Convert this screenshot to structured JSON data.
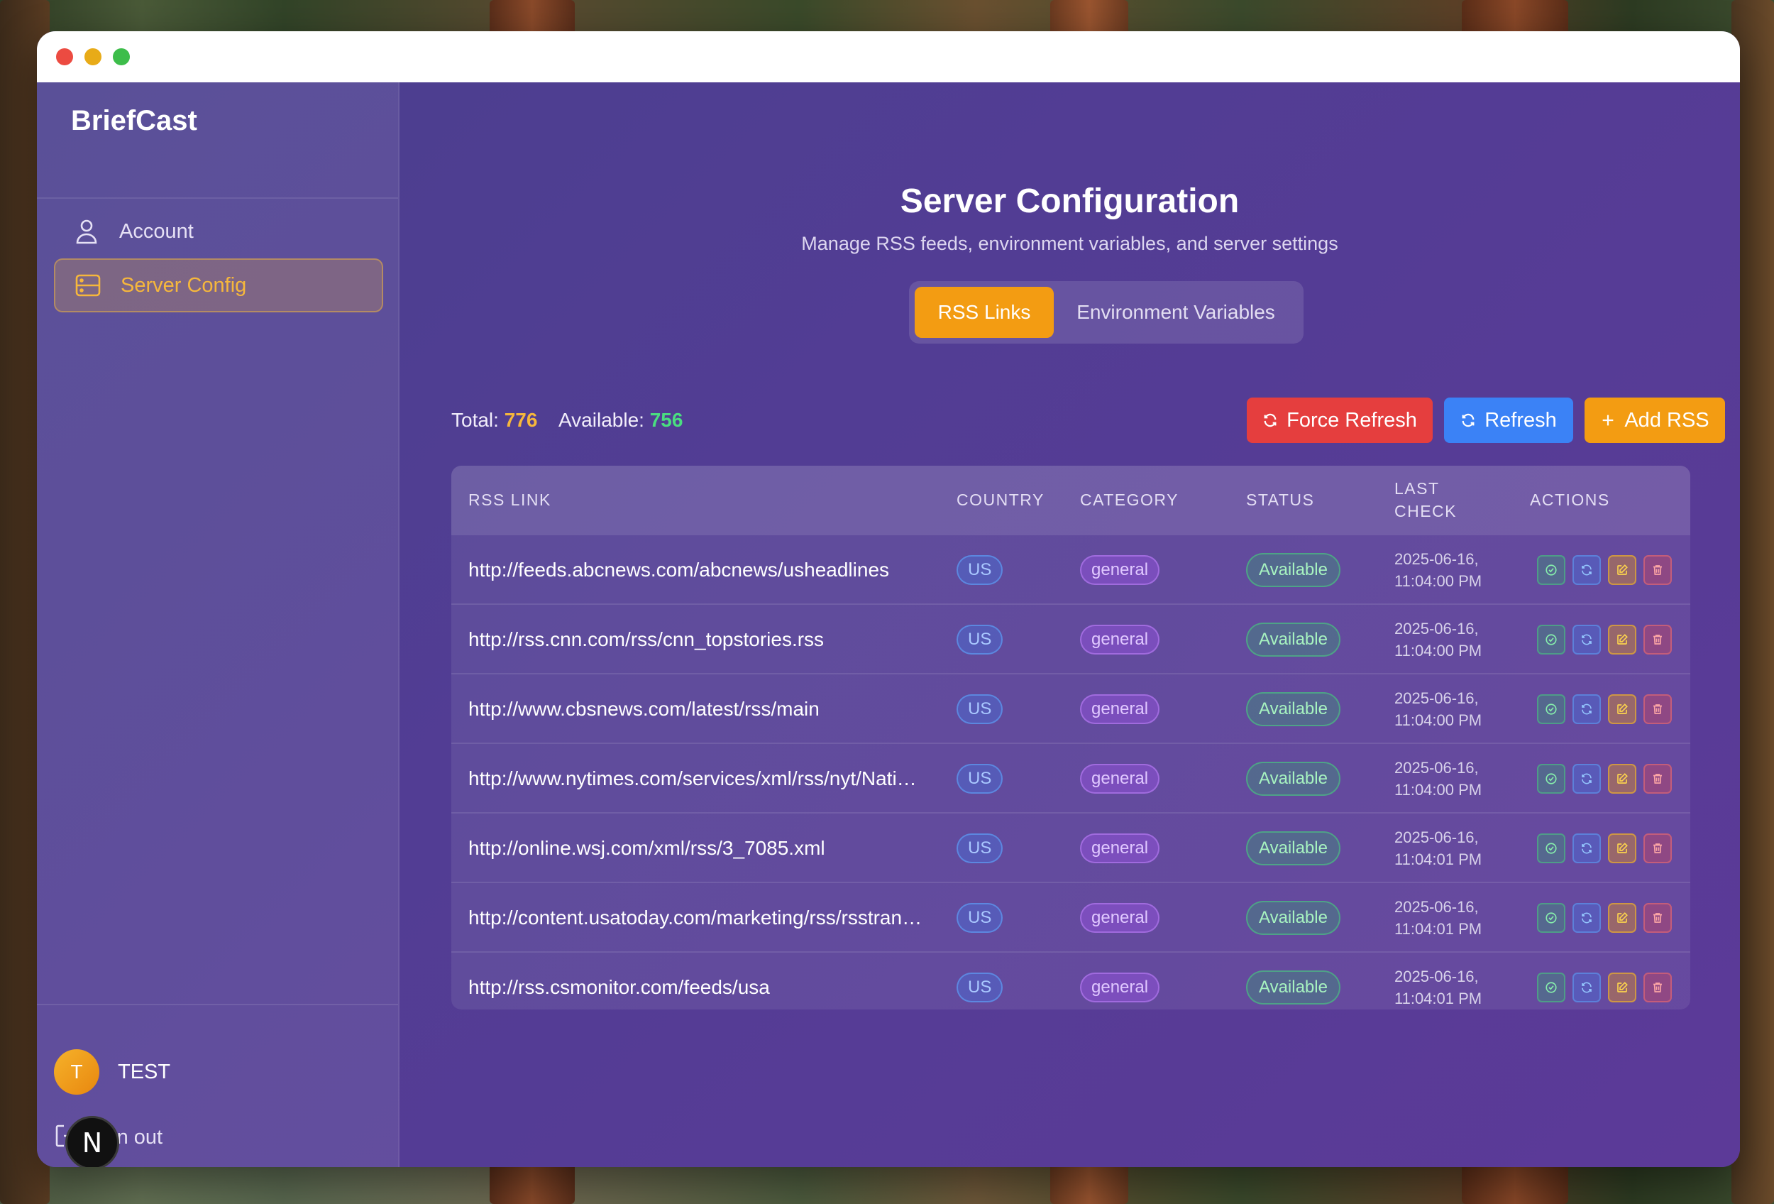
{
  "window": {
    "traffic_lights": [
      "#ec4b41",
      "#e8ab18",
      "#3dbd4a"
    ]
  },
  "sidebar": {
    "brand": "BriefCast",
    "items": [
      {
        "label": "Account",
        "icon": "user-icon",
        "active": false
      },
      {
        "label": "Server Config",
        "icon": "server-icon",
        "active": true
      }
    ],
    "user": {
      "initial": "T",
      "name": "TEST"
    },
    "signout_label": "ign out",
    "overlay_badge": "N"
  },
  "main": {
    "title": "Server Configuration",
    "subtitle": "Manage RSS feeds, environment variables, and server settings",
    "tabs": [
      {
        "label": "RSS Links",
        "active": true
      },
      {
        "label": "Environment Variables",
        "active": false
      }
    ],
    "stats": {
      "total_label": "Total:",
      "total_value": "776",
      "available_label": "Available:",
      "available_value": "756"
    },
    "buttons": {
      "force_refresh": "Force Refresh",
      "refresh": "Refresh",
      "add_rss": "Add RSS"
    },
    "colors": {
      "accent": "#f39c12",
      "danger": "#e53e3e",
      "primary": "#3b82f6",
      "total_value": "#f6b73c",
      "available_value": "#4ade80"
    }
  },
  "table": {
    "headers": {
      "link": "RSS LINK",
      "country": "COUNTRY",
      "category": "CATEGORY",
      "status": "STATUS",
      "last_check_1": "LAST",
      "last_check_2": "CHECK",
      "actions": "ACTIONS"
    },
    "rows": [
      {
        "link": "http://feeds.abcnews.com/abcnews/usheadlines",
        "country": "US",
        "category": "general",
        "status": "Available",
        "date": "2025-06-16,",
        "time": "11:04:00 PM"
      },
      {
        "link": "http://rss.cnn.com/rss/cnn_topstories.rss",
        "country": "US",
        "category": "general",
        "status": "Available",
        "date": "2025-06-16,",
        "time": "11:04:00 PM"
      },
      {
        "link": "http://www.cbsnews.com/latest/rss/main",
        "country": "US",
        "category": "general",
        "status": "Available",
        "date": "2025-06-16,",
        "time": "11:04:00 PM"
      },
      {
        "link": "http://www.nytimes.com/services/xml/rss/nyt/Nati…",
        "country": "US",
        "category": "general",
        "status": "Available",
        "date": "2025-06-16,",
        "time": "11:04:00 PM"
      },
      {
        "link": "http://online.wsj.com/xml/rss/3_7085.xml",
        "country": "US",
        "category": "general",
        "status": "Available",
        "date": "2025-06-16,",
        "time": "11:04:01 PM"
      },
      {
        "link": "http://content.usatoday.com/marketing/rss/rsstran…",
        "country": "US",
        "category": "general",
        "status": "Available",
        "date": "2025-06-16,",
        "time": "11:04:01 PM"
      },
      {
        "link": "http://rss.csmonitor.com/feeds/usa",
        "country": "US",
        "category": "general",
        "status": "Available",
        "date": "2025-06-16,",
        "time": "11:04:01 PM"
      }
    ],
    "row_actions": [
      "check-icon",
      "refresh-icon",
      "edit-icon",
      "trash-icon"
    ]
  }
}
